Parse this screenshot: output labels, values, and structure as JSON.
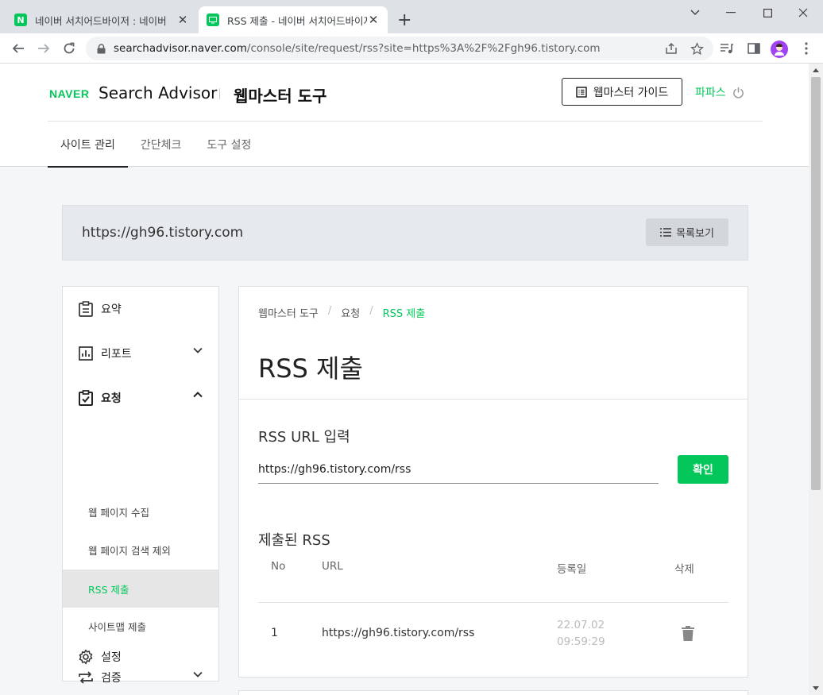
{
  "browser": {
    "tabs": [
      {
        "title": "네이버 서치어드바이저 : 네이버",
        "favicon": "naver-n-icon",
        "active": false
      },
      {
        "title": "RSS 제출 - 네이버 서치어드바이저",
        "favicon": "monitor-icon",
        "active": true
      }
    ],
    "favicon_letter": "N",
    "url_host": "searchadvisor.naver.com",
    "url_path": "/console/site/request/rss?site=https%3A%2F%2Fgh96.tistory.com"
  },
  "header": {
    "logo_naver": "NAVER",
    "logo_product": "Search Advisor",
    "logo_tool": "웹마스터 도구",
    "guide_label": "웹마스터 가이드",
    "user_name": "파파스",
    "nav": [
      "사이트 관리",
      "간단체크",
      "도구 설정"
    ]
  },
  "site": {
    "url": "https://gh96.tistory.com",
    "list_label": "목록보기"
  },
  "sidebar": {
    "menu": {
      "summary": "요약",
      "report": "리포트",
      "request": "요청",
      "verify": "검증",
      "settings": "설정"
    },
    "sub": [
      "웹 페이지 수집",
      "웹 페이지 검색 제외",
      "RSS 제출",
      "사이트맵 제출"
    ]
  },
  "main": {
    "breadcrumb": [
      "웹마스터 도구",
      "요청",
      "RSS 제출"
    ],
    "breadcrumb_sep": "/",
    "title": "RSS 제출",
    "input_title": "RSS URL 입력",
    "input_value": "https://gh96.tistory.com/rss",
    "confirm_label": "확인",
    "submitted_title": "제출된 RSS",
    "table": {
      "headers": {
        "no": "No",
        "url": "URL",
        "date": "등록일",
        "delete": "삭제"
      },
      "rows": [
        {
          "no": "1",
          "url": "https://gh96.tistory.com/rss",
          "date": "22.07.02 09:59:29"
        }
      ]
    }
  },
  "colors": {
    "accent": "#03c75a"
  }
}
